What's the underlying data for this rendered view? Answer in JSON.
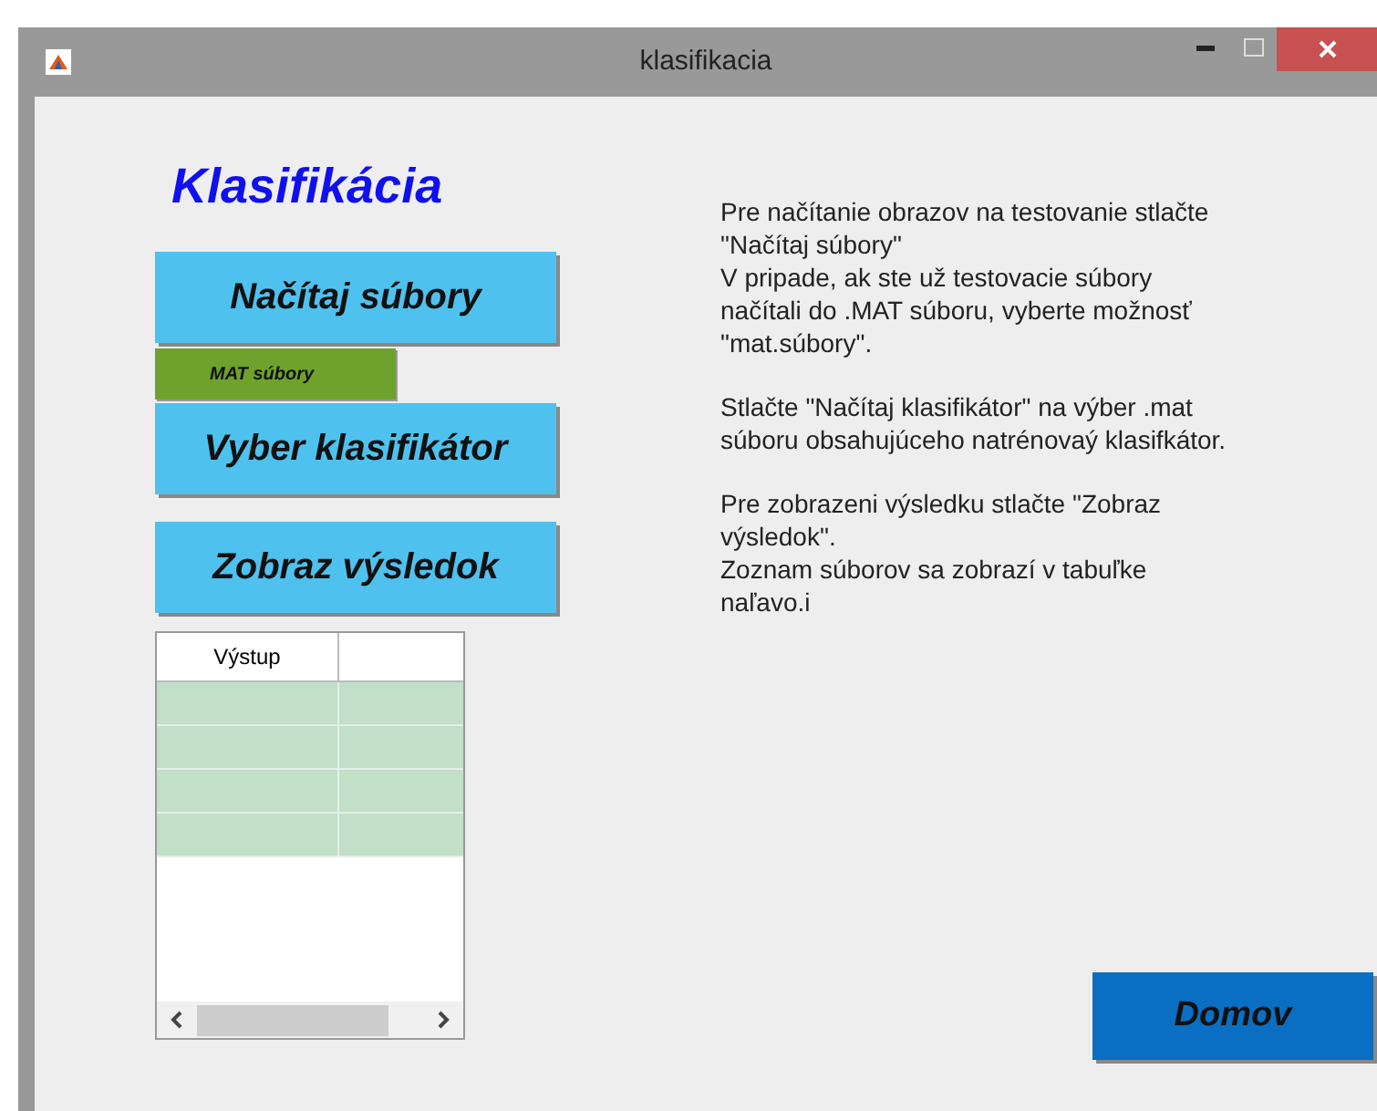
{
  "window": {
    "title": "klasifikacia"
  },
  "heading": "Klasifikácia",
  "buttons": [
    {
      "label": "Načítaj súbory",
      "kind": "main"
    },
    {
      "label": "MAT súbory",
      "kind": "small"
    },
    {
      "label": "Vyber klasifikátor",
      "kind": "main"
    },
    {
      "label": "Zobraz výsledok",
      "kind": "main"
    }
  ],
  "table": {
    "columns": [
      "Výstup"
    ],
    "rows": [
      {
        "highlighted": true
      },
      {
        "highlighted": true
      },
      {
        "highlighted": true
      },
      {
        "highlighted": true
      }
    ]
  },
  "instructions": [
    [
      "Pre načítanie obrazov na testovanie stlačte",
      "\"Načítaj súbory\"",
      "V pripade, ak ste už testovacie súbory",
      "načítali do .MAT súboru, vyberte možnosť",
      "\"mat.súbory\"."
    ],
    [
      "Stlačte \"Načítaj klasifikátor\" na výber .mat",
      "súboru obsahujúceho natrénovaý klasifkátor."
    ],
    [
      "Pre zobrazeni výsledku stlačte \"Zobraz",
      "výsledok\".",
      "Zoznam súborov sa zobrazí v tabuľke",
      "naľavo.i"
    ]
  ],
  "home_button": "Domov"
}
